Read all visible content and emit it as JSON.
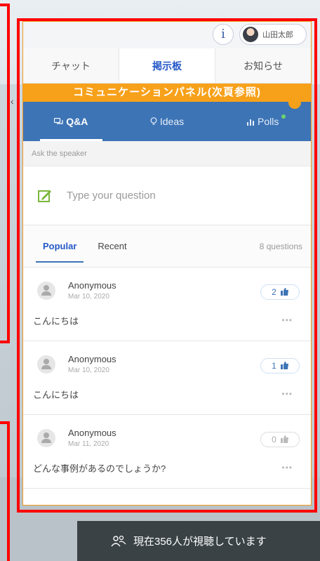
{
  "top_bar": {
    "info_label": "i",
    "user_name": "山田太郎"
  },
  "nav_tabs": [
    {
      "label": "チャット",
      "active": false
    },
    {
      "label": "掲示板",
      "active": true
    },
    {
      "label": "お知らせ",
      "active": false
    }
  ],
  "banner": "コミュニケーションパネル(次頁参照)",
  "qa_tabs": [
    {
      "label": "Q&A",
      "icon": "chat-bubbles-icon",
      "active": true
    },
    {
      "label": "Ideas",
      "icon": "lightbulb-icon",
      "active": false
    },
    {
      "label": "Polls",
      "icon": "bar-chart-icon",
      "active": false
    }
  ],
  "ask": {
    "label": "Ask the speaker",
    "placeholder": "Type your question"
  },
  "sort": {
    "popular": "Popular",
    "recent": "Recent",
    "count": "8 questions"
  },
  "questions": [
    {
      "author": "Anonymous",
      "date": "Mar 10, 2020",
      "text": "こんにちは",
      "likes": "2"
    },
    {
      "author": "Anonymous",
      "date": "Mar 10, 2020",
      "text": "こんにちは",
      "likes": "1"
    },
    {
      "author": "Anonymous",
      "date": "Mar 11, 2020",
      "text": "どんな事例があるのでしょうか?",
      "likes": "0"
    }
  ],
  "viewers": "現在356人が視聴しています",
  "colors": {
    "accent_blue": "#3d74b6",
    "banner_orange": "#f7a11a",
    "highlight_red": "#ff0000"
  }
}
